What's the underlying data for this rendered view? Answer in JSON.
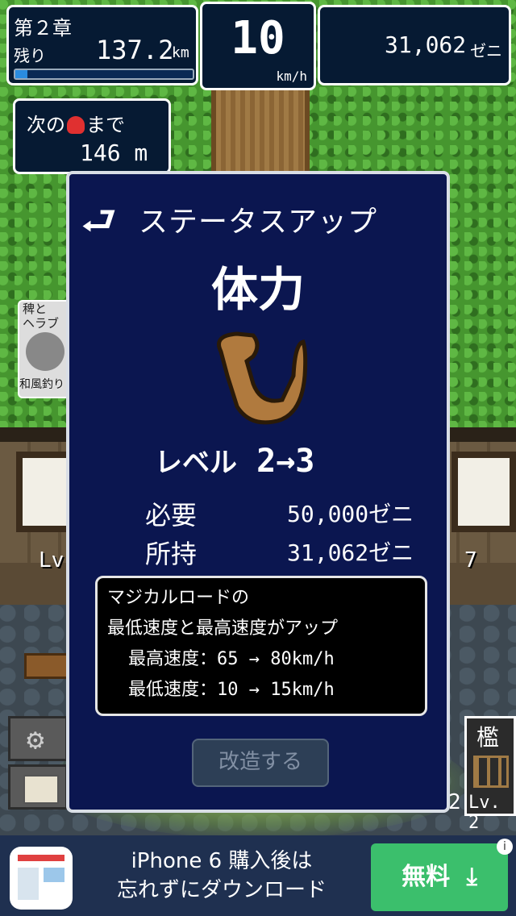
{
  "hud": {
    "chapter": "第２章",
    "remaining_label": "残り",
    "remaining_value": "137.2",
    "remaining_unit": "km",
    "progress": 0.07,
    "speed_value": "10",
    "speed_unit": "km/h",
    "money_value": "31,062",
    "money_unit": "ゼニ"
  },
  "bubble": {
    "line1_prefix": "次の",
    "line1_suffix": "まで",
    "distance": "146 m"
  },
  "side_ad": {
    "title": "稗と\nヘラブ",
    "caption": "和風釣り"
  },
  "background": {
    "left_scroll_level": "Lv.",
    "right_scroll_level": "7"
  },
  "right_panel": {
    "label": "檻",
    "level": "Lv. 2",
    "partial": "2"
  },
  "modal": {
    "title": "ステータスアップ",
    "stat_name": "体力",
    "level_label": "レベル",
    "level_text": "2→3",
    "required_label": "必要",
    "required_value": "50,000ゼニ",
    "owned_label": "所持",
    "owned_value": "31,062ゼニ",
    "desc_line1": "マジカルロードの",
    "desc_line2": "最低速度と最高速度がアップ",
    "desc_line3": "最高速度：65 → 80km/h",
    "desc_line4": "最低速度：10 → 15km/h",
    "upgrade_button": "改造する"
  },
  "ad": {
    "line1": "iPhone 6 購入後は",
    "line2": "忘れずにダウンロード",
    "button": "無料",
    "info": "i"
  }
}
